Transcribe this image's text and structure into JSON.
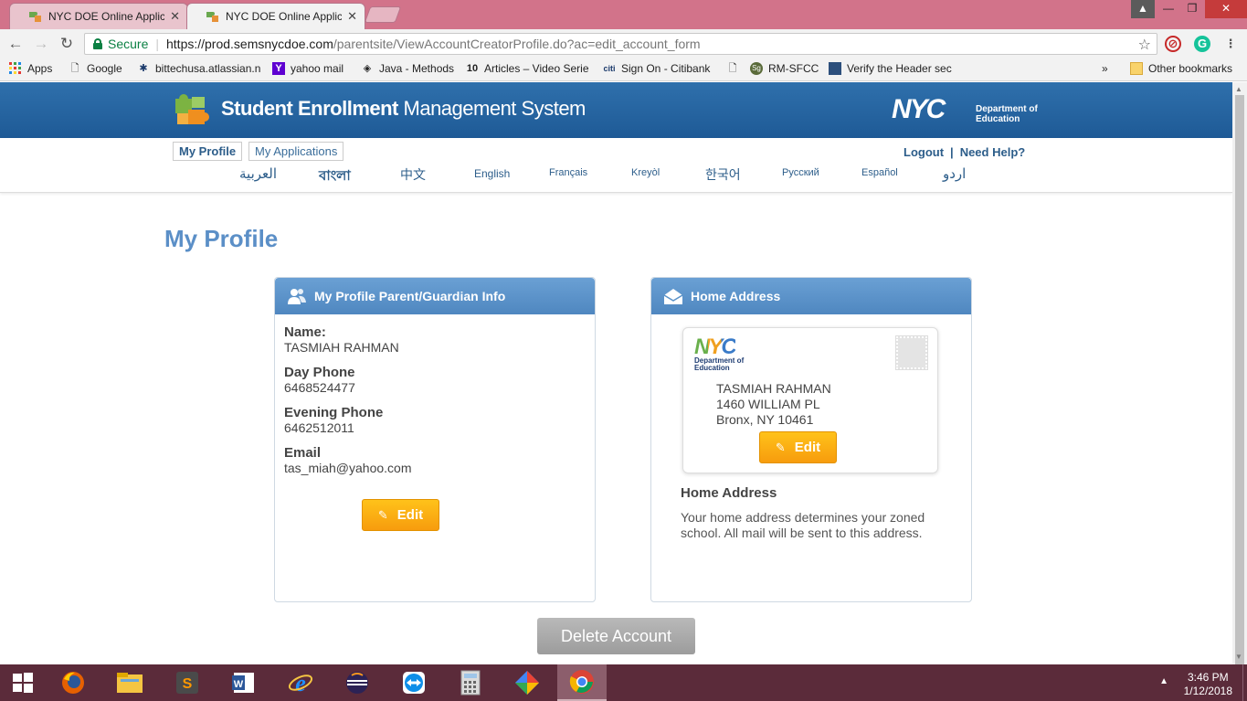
{
  "browser": {
    "tabs": [
      {
        "title": "NYC DOE Online Applica",
        "active": false
      },
      {
        "title": "NYC DOE Online Applica",
        "active": true
      }
    ],
    "omnibox": {
      "secure_label": "Secure",
      "url_host": "https://prod.semsnycdoe.com",
      "url_path": "/parentsite/ViewAccountCreatorProfile.do?ac=edit_account_form"
    },
    "bookmarks": [
      {
        "label": "Apps",
        "icon": "apps-grid-icon"
      },
      {
        "label": "Google",
        "icon": "page-icon"
      },
      {
        "label": "bittechusa.atlassian.n",
        "icon": "atlassian-icon"
      },
      {
        "label": "yahoo mail",
        "icon": "yahoo-icon"
      },
      {
        "label": "Java - Methods",
        "icon": "diamond-icon"
      },
      {
        "label": "Articles – Video Serie",
        "icon": "articles-icon"
      },
      {
        "label": "Sign On - Citibank",
        "icon": "citi-icon"
      },
      {
        "label": "",
        "icon": "page-icon"
      },
      {
        "label": "RM-SFCC",
        "icon": "sg-icon"
      },
      {
        "label": "Verify the Header sec",
        "icon": "grid-icon"
      }
    ],
    "bookmarks_overflow": "»",
    "other_bookmarks": "Other bookmarks"
  },
  "site": {
    "title_bold": "Student Enrollment",
    "title_rest": " Management System",
    "nyc_logo": "NYC",
    "doe_line1": "Department of",
    "doe_line2": "Education"
  },
  "subnav": {
    "my_profile": "My Profile",
    "my_applications": "My Applications",
    "logout": "Logout",
    "separator": "|",
    "need_help": "Need Help?",
    "languages": [
      "العربية",
      "বাংলা",
      "中文",
      "English",
      "Français",
      "Kreyòl",
      "한국어",
      "Русский",
      "Español",
      "اردو"
    ]
  },
  "page": {
    "title": "My Profile"
  },
  "profile_card": {
    "heading": "My Profile Parent/Guardian Info",
    "name_label": "Name:",
    "name_value": "TASMIAH RAHMAN",
    "day_phone_label": "Day Phone",
    "day_phone_value": "6468524477",
    "evening_phone_label": "Evening Phone",
    "evening_phone_value": "6462512011",
    "email_label": "Email",
    "email_value": "tas_miah@yahoo.com",
    "edit_label": "Edit"
  },
  "address_card": {
    "heading": "Home Address",
    "envelope_logo": "NYC",
    "envelope_doe_line1": "Department of",
    "envelope_doe_line2": "Education",
    "address_line1": "TASMIAH RAHMAN",
    "address_line2": "1460 WILLIAM PL",
    "address_line3": "Bronx, NY 10461",
    "edit_label": "Edit",
    "note_title": "Home Address",
    "note_text": "Your home address determines your zoned school. All mail will be sent to this address."
  },
  "delete_label": "Delete Account",
  "taskbar": {
    "time": "3:46 PM",
    "date": "1/12/2018"
  },
  "colors": {
    "header_blue": "#2f70ac",
    "title_blue": "#5b8fc7",
    "edit_orange": "#f7a70f",
    "delete_gray": "#a8a8a8",
    "taskbar": "#5b2b3a",
    "tabbar": "#d2738a"
  }
}
